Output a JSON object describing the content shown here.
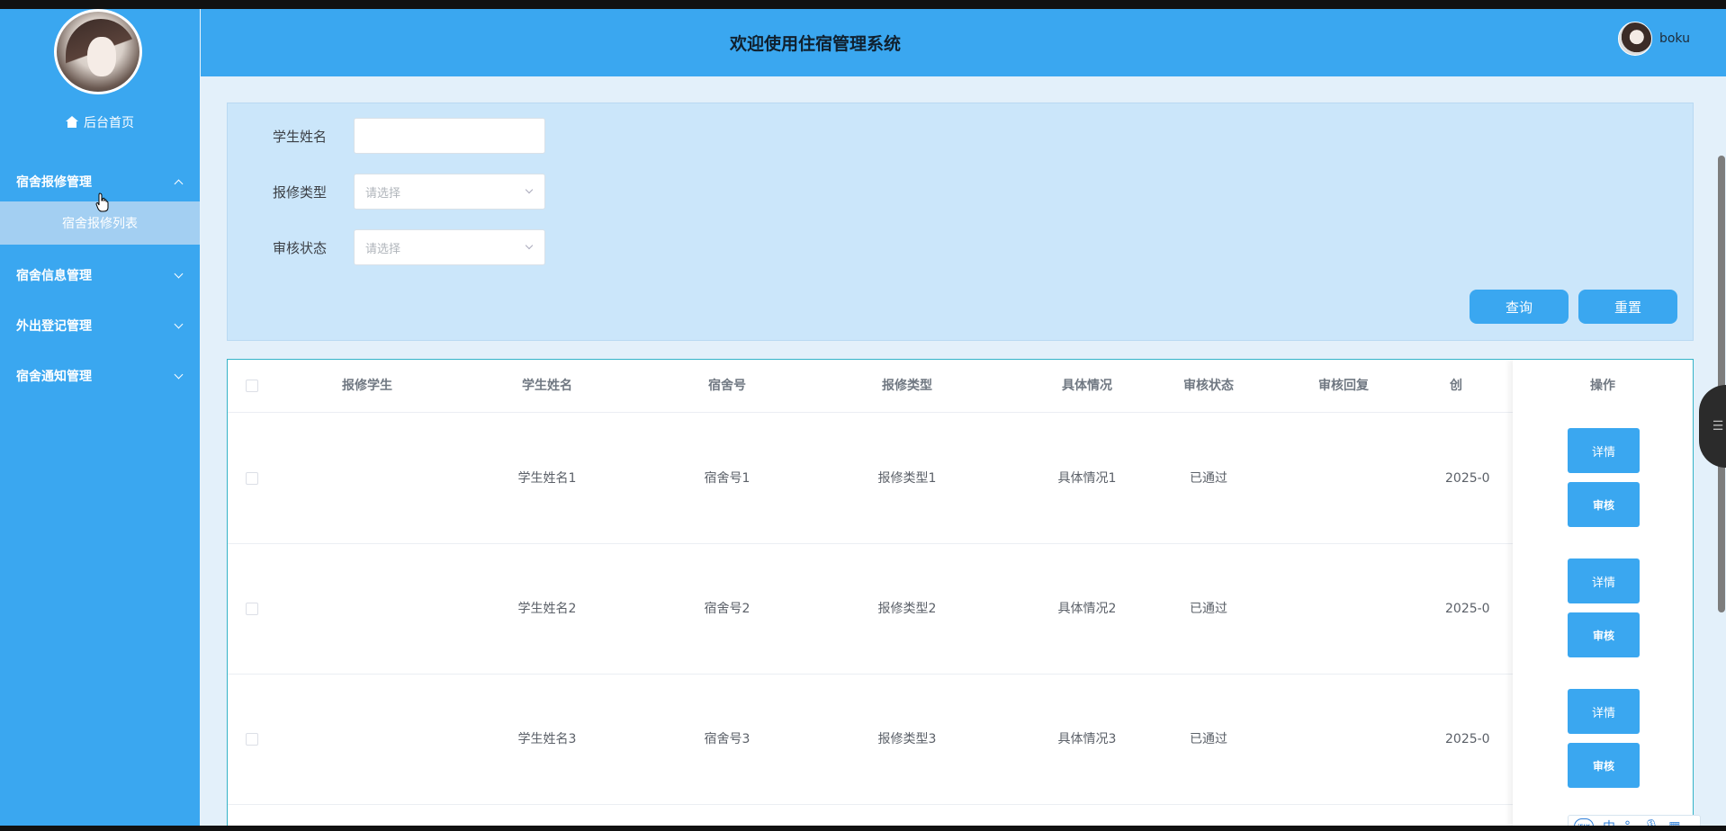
{
  "sidebar": {
    "home_label": "后台首页",
    "menus": [
      {
        "label": "宿舍报修管理",
        "expanded": true,
        "children": [
          "宿舍报修列表"
        ]
      },
      {
        "label": "宿舍信息管理",
        "expanded": false
      },
      {
        "label": "外出登记管理",
        "expanded": false
      },
      {
        "label": "宿舍通知管理",
        "expanded": false
      }
    ]
  },
  "header": {
    "title": "欢迎使用住宿管理系统",
    "username": "boku"
  },
  "search": {
    "student_name_label": "学生姓名",
    "student_name_value": "",
    "repair_type_label": "报修类型",
    "repair_type_placeholder": "请选择",
    "review_status_label": "审核状态",
    "review_status_placeholder": "请选择",
    "query_button": "查询",
    "reset_button": "重置"
  },
  "table": {
    "columns": [
      "报修学生",
      "学生姓名",
      "宿舍号",
      "报修类型",
      "具体情况",
      "审核状态",
      "审核回复",
      "创",
      "操作"
    ],
    "rows": [
      {
        "student": "",
        "name": "学生姓名1",
        "room": "宿舍号1",
        "type": "报修类型1",
        "detail": "具体情况1",
        "status": "已通过",
        "reply": "",
        "created": "2025-0"
      },
      {
        "student": "",
        "name": "学生姓名2",
        "room": "宿舍号2",
        "type": "报修类型2",
        "detail": "具体情况2",
        "status": "已通过",
        "reply": "",
        "created": "2025-0"
      },
      {
        "student": "",
        "name": "学生姓名3",
        "room": "宿舍号3",
        "type": "报修类型3",
        "detail": "具体情况3",
        "status": "已通过",
        "reply": "",
        "created": "2025-0"
      }
    ],
    "detail_button": "详情",
    "review_button": "审核"
  },
  "ime": {
    "logo": "iFLY",
    "lang": "中"
  },
  "colors": {
    "primary": "#3aa7f0",
    "submenu_active": "#a3cff2",
    "search_panel": "#cbe6fa",
    "table_border": "#34b3c7"
  }
}
